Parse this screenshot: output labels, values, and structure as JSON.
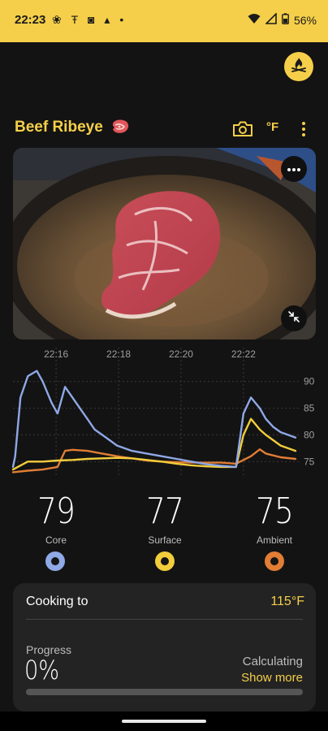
{
  "status_bar": {
    "time": "22:23",
    "notification_glyphs": "❀ Ŧ ◙ ▴ •",
    "battery": "56%"
  },
  "header": {
    "title": "Beef Ribeye",
    "unit_toggle": "°F",
    "icons": [
      "camera-icon",
      "more-vertical-icon",
      "flame-logo-icon",
      "steak-icon"
    ]
  },
  "chart_data": {
    "type": "line",
    "x_ticks": [
      "22:16",
      "22:18",
      "22:20",
      "22:22"
    ],
    "y_ticks": [
      90,
      85,
      80,
      75
    ],
    "ylim": [
      72,
      93
    ],
    "grid": true,
    "series": [
      {
        "name": "Core",
        "color": "#8fa8e6",
        "x": [
          0,
          0.15,
          0.5,
          1,
          1.6,
          2,
          2.3,
          2.6,
          3,
          3.1,
          3.5,
          4.5,
          5,
          5.5,
          6,
          6.5,
          7,
          8,
          9,
          10,
          11,
          12,
          13,
          14,
          14.5,
          15,
          15.5,
          16,
          16.6,
          17,
          17.5,
          18,
          18.5,
          19
        ],
        "y": [
          74,
          76,
          87,
          91,
          92,
          90,
          88,
          86,
          84,
          85,
          89,
          85,
          83,
          81,
          80,
          79,
          78,
          77,
          76.5,
          76,
          75.5,
          75,
          74.5,
          74.2,
          74.1,
          74,
          84,
          87,
          85,
          83,
          81.5,
          80.5,
          80,
          79.5
        ]
      },
      {
        "name": "Surface",
        "color": "#f2cd3c",
        "x": [
          0,
          1,
          2,
          3,
          4,
          5,
          6,
          7,
          8,
          9,
          10,
          11,
          12,
          13,
          14,
          15,
          15.5,
          16,
          16.6,
          17,
          18,
          19
        ],
        "y": [
          73.5,
          75,
          75,
          75.2,
          75.3,
          75.5,
          75.6,
          75.7,
          75.6,
          75.3,
          75,
          74.6,
          74.3,
          74.1,
          74,
          74,
          80,
          83,
          81,
          80,
          78,
          77
        ]
      },
      {
        "name": "Ambient",
        "color": "#e17d35",
        "x": [
          0,
          1,
          2,
          3,
          3.5,
          4,
          5,
          6,
          7,
          8,
          9,
          10,
          11,
          12,
          13,
          14,
          15,
          16,
          16.6,
          17,
          18,
          19
        ],
        "y": [
          73,
          73.3,
          73.5,
          74,
          77,
          77.2,
          77,
          76.5,
          76,
          75.6,
          75.2,
          75,
          74.9,
          74.8,
          74.8,
          74.8,
          74.6,
          76,
          77.3,
          76.5,
          75.8,
          75.5
        ]
      }
    ]
  },
  "readings": [
    {
      "value": "79",
      "label": "Core",
      "color": "#8fa8e6"
    },
    {
      "value": "77",
      "label": "Surface",
      "color": "#f2cd3c"
    },
    {
      "value": "75",
      "label": "Ambient",
      "color": "#e17d35"
    }
  ],
  "cook_card": {
    "target_label": "Cooking to",
    "target_value": "115°F",
    "progress_label": "Progress",
    "progress_value": "0%",
    "progress_fraction": 0,
    "status": "Calculating",
    "show_more": "Show more"
  }
}
